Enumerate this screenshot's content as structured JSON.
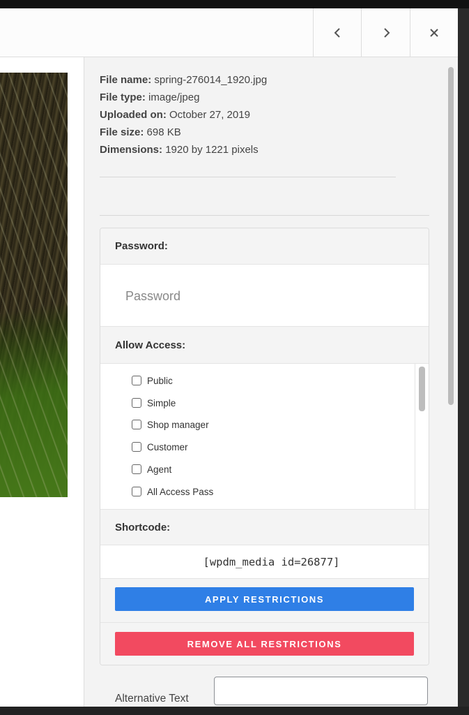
{
  "navigation": {
    "prev_icon": "chevron-left-icon",
    "next_icon": "chevron-right-icon",
    "close_icon": "close-icon"
  },
  "file_info": {
    "name_label": "File name:",
    "name_value": "spring-276014_1920.jpg",
    "type_label": "File type:",
    "type_value": "image/jpeg",
    "uploaded_label": "Uploaded on:",
    "uploaded_value": "October 27, 2019",
    "size_label": "File size:",
    "size_value": "698 KB",
    "dimensions_label": "Dimensions:",
    "dimensions_value": "1920 by 1221 pixels"
  },
  "restrictions": {
    "password_header": "Password:",
    "password_placeholder": "Password",
    "allow_access_header": "Allow Access:",
    "roles": [
      "Public",
      "Simple",
      "Shop manager",
      "Customer",
      "Agent",
      "All Access Pass"
    ],
    "shortcode_header": "Shortcode:",
    "shortcode_value": "[wpdm_media id=26877]",
    "apply_label": "APPLY RESTRICTIONS",
    "remove_label": "REMOVE ALL RESTRICTIONS"
  },
  "attachment": {
    "alt_text_label": "Alternative Text",
    "alt_text_value": ""
  },
  "colors": {
    "apply_button": "#2f7fe6",
    "remove_button": "#f24a60",
    "panel_header_bg": "#f4f4f4"
  }
}
